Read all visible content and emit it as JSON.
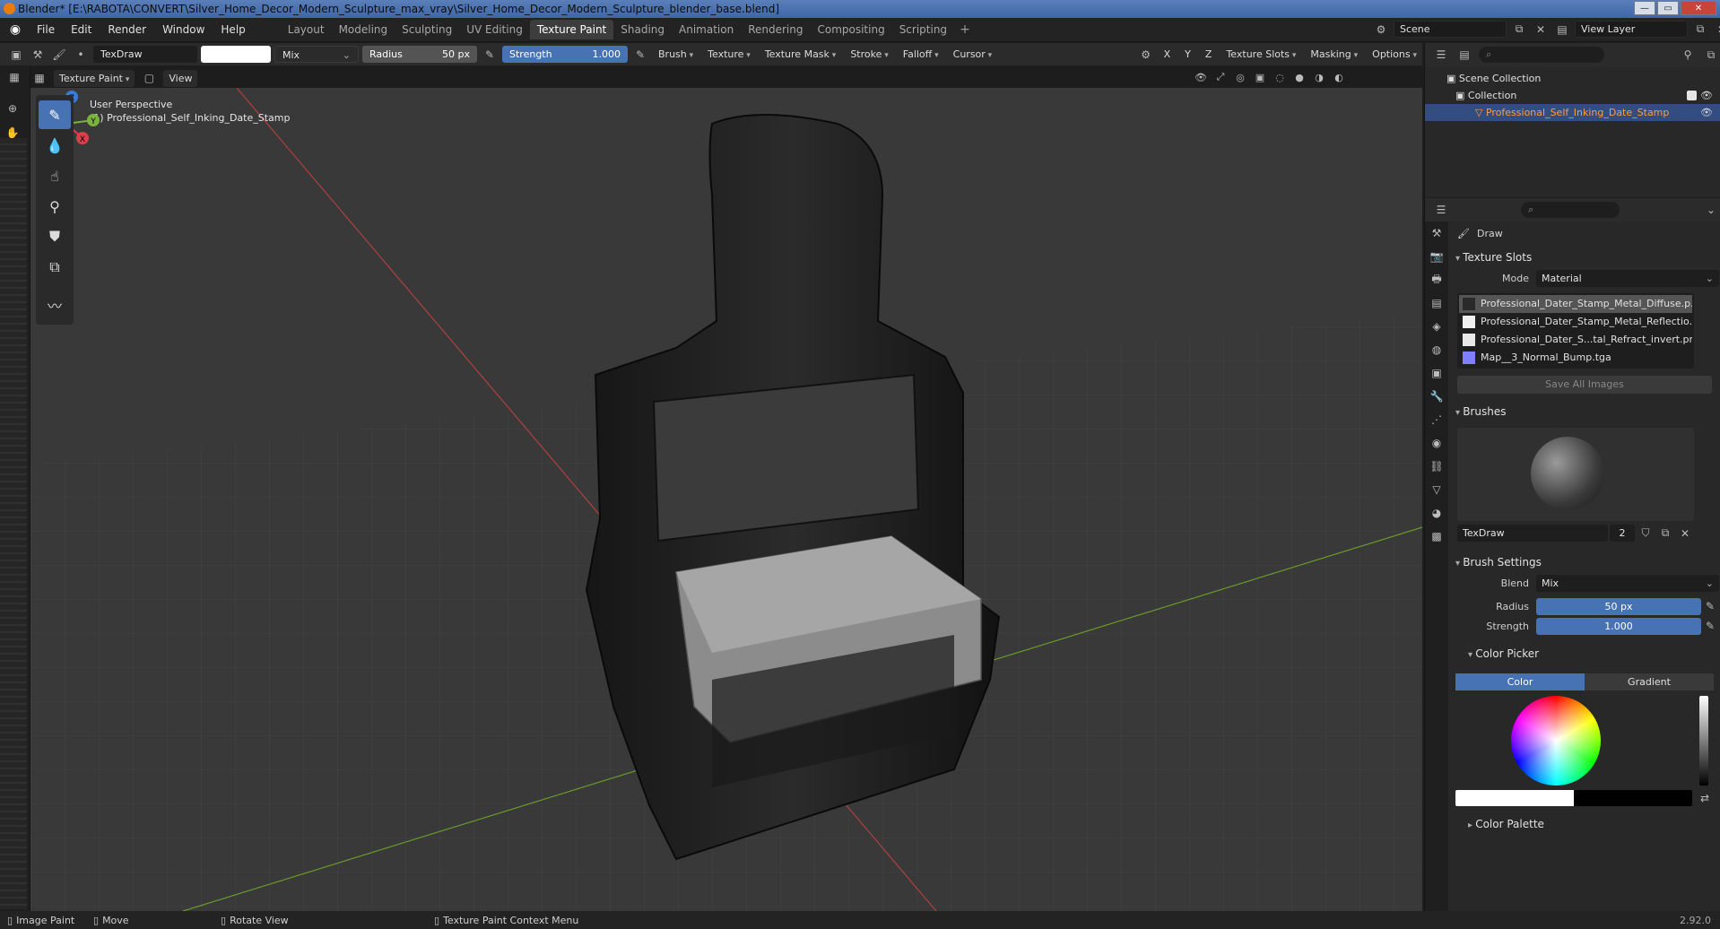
{
  "window": {
    "title": "Blender* [E:\\RABOTA\\CONVERT\\Silver_Home_Decor_Modern_Sculpture_max_vray\\Silver_Home_Decor_Modern_Sculpture_blender_base.blend]"
  },
  "menu": [
    "File",
    "Edit",
    "Render",
    "Window",
    "Help"
  ],
  "workspaces": [
    {
      "label": "Layout"
    },
    {
      "label": "Modeling"
    },
    {
      "label": "Sculpting"
    },
    {
      "label": "UV Editing"
    },
    {
      "label": "Texture Paint",
      "active": true
    },
    {
      "label": "Shading"
    },
    {
      "label": "Animation"
    },
    {
      "label": "Rendering"
    },
    {
      "label": "Compositing"
    },
    {
      "label": "Scripting"
    }
  ],
  "scene": {
    "name": "Scene",
    "view_layer": "View Layer"
  },
  "toolheader": {
    "brush_name": "TexDraw",
    "blend": "Mix",
    "radius_label": "Radius",
    "radius_value": "50 px",
    "strength_label": "Strength",
    "strength_value": "1.000",
    "menus": [
      "Brush",
      "Texture",
      "Texture Mask",
      "Stroke",
      "Falloff",
      "Cursor"
    ],
    "axes": [
      "X",
      "Y",
      "Z"
    ],
    "right_menus": [
      "Texture Slots",
      "Masking",
      "Options"
    ]
  },
  "viewport_header": {
    "mode": "Texture Paint",
    "view": "View"
  },
  "viewport": {
    "perspective": "User Perspective",
    "object_label": "(1) Professional_Self_Inking_Date_Stamp"
  },
  "gizmo": {
    "z": "Z",
    "y": "Y",
    "x": "X"
  },
  "outliner": {
    "search_placeholder": "",
    "scene_collection": "Scene Collection",
    "collection": "Collection",
    "object": "Professional_Self_Inking_Date_Stamp"
  },
  "properties": {
    "tool_name": "Draw",
    "texture_slots_title": "Texture Slots",
    "mode_label": "Mode",
    "mode_value": "Material",
    "slots": [
      {
        "name": "Professional_Dater_Stamp_Metal_Diffuse.p...",
        "selected": true,
        "color": "#2a2a2a"
      },
      {
        "name": "Professional_Dater_Stamp_Metal_Reflectio...",
        "selected": false,
        "color": "#f0f0f0"
      },
      {
        "name": "Professional_Dater_S...tal_Refract_invert.png",
        "selected": false,
        "color": "#e8e8e8"
      },
      {
        "name": "Map__3_Normal_Bump.tga",
        "selected": false,
        "color": "#8080ff"
      }
    ],
    "save_all": "Save All Images",
    "brushes_title": "Brushes",
    "brush_name": "TexDraw",
    "brush_users": "2",
    "brush_settings_title": "Brush Settings",
    "blend_label": "Blend",
    "blend_value": "Mix",
    "radius_label": "Radius",
    "radius_value": "50 px",
    "strength_label": "Strength",
    "strength_value": "1.000",
    "color_picker_title": "Color Picker",
    "color_tab": "Color",
    "gradient_tab": "Gradient",
    "color_palette_title": "Color Palette"
  },
  "statusbar": {
    "items": [
      "Image Paint",
      "Move",
      "Rotate View",
      "Texture Paint Context Menu"
    ],
    "version": "2.92.0"
  },
  "colors": {
    "accent": "#4772b3",
    "selected_object": "#ff9d3c",
    "viewport_bg": "#3a3a3a"
  }
}
